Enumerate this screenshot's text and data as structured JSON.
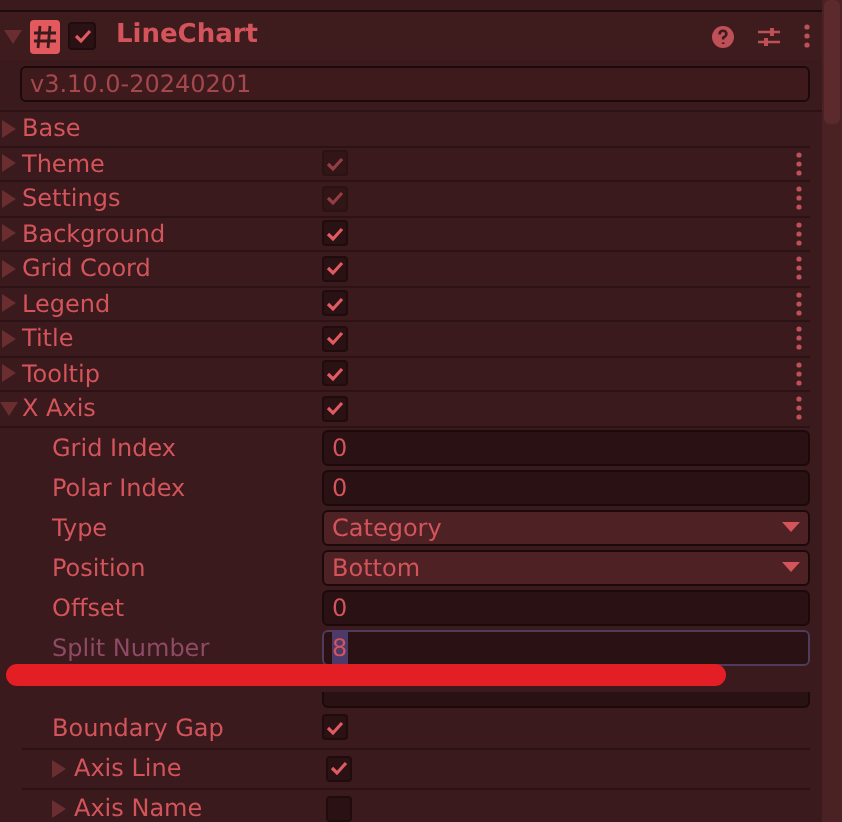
{
  "header": {
    "title": "LineChart",
    "enabled": true
  },
  "version": "v3.10.0-20240201",
  "sections": [
    {
      "kind": "plain",
      "label": "Base",
      "expanded": false
    },
    {
      "kind": "toggle",
      "label": "Theme",
      "expanded": false,
      "checked": true,
      "disabled": true
    },
    {
      "kind": "toggle",
      "label": "Settings",
      "expanded": false,
      "checked": true,
      "disabled": true
    },
    {
      "kind": "toggle",
      "label": "Background",
      "expanded": false,
      "checked": true,
      "disabled": false
    },
    {
      "kind": "toggle",
      "label": "Grid Coord",
      "expanded": false,
      "checked": true,
      "disabled": false
    },
    {
      "kind": "toggle",
      "label": "Legend",
      "expanded": false,
      "checked": true,
      "disabled": false
    },
    {
      "kind": "toggle",
      "label": "Title",
      "expanded": false,
      "checked": true,
      "disabled": false
    },
    {
      "kind": "toggle",
      "label": "Tooltip",
      "expanded": false,
      "checked": true,
      "disabled": false
    },
    {
      "kind": "toggle",
      "label": "X Axis",
      "expanded": true,
      "checked": true,
      "disabled": false,
      "children": [
        {
          "kind": "number",
          "label": "Grid Index",
          "value": "0",
          "focused": false
        },
        {
          "kind": "number",
          "label": "Polar Index",
          "value": "0",
          "focused": false
        },
        {
          "kind": "dropdown",
          "label": "Type",
          "value": "Category"
        },
        {
          "kind": "dropdown",
          "label": "Position",
          "value": "Bottom"
        },
        {
          "kind": "number",
          "label": "Offset",
          "value": "0",
          "focused": false
        },
        {
          "kind": "number",
          "label": "Split Number",
          "value": "8",
          "focused": true
        },
        {
          "kind": "covered-field"
        },
        {
          "kind": "checkbox",
          "label": "Boundary Gap",
          "checked": true
        },
        {
          "kind": "foldout",
          "label": "Axis Line",
          "expanded": false,
          "checked": true
        },
        {
          "kind": "foldout",
          "label": "Axis Name",
          "expanded": false,
          "checked": false
        }
      ]
    }
  ]
}
